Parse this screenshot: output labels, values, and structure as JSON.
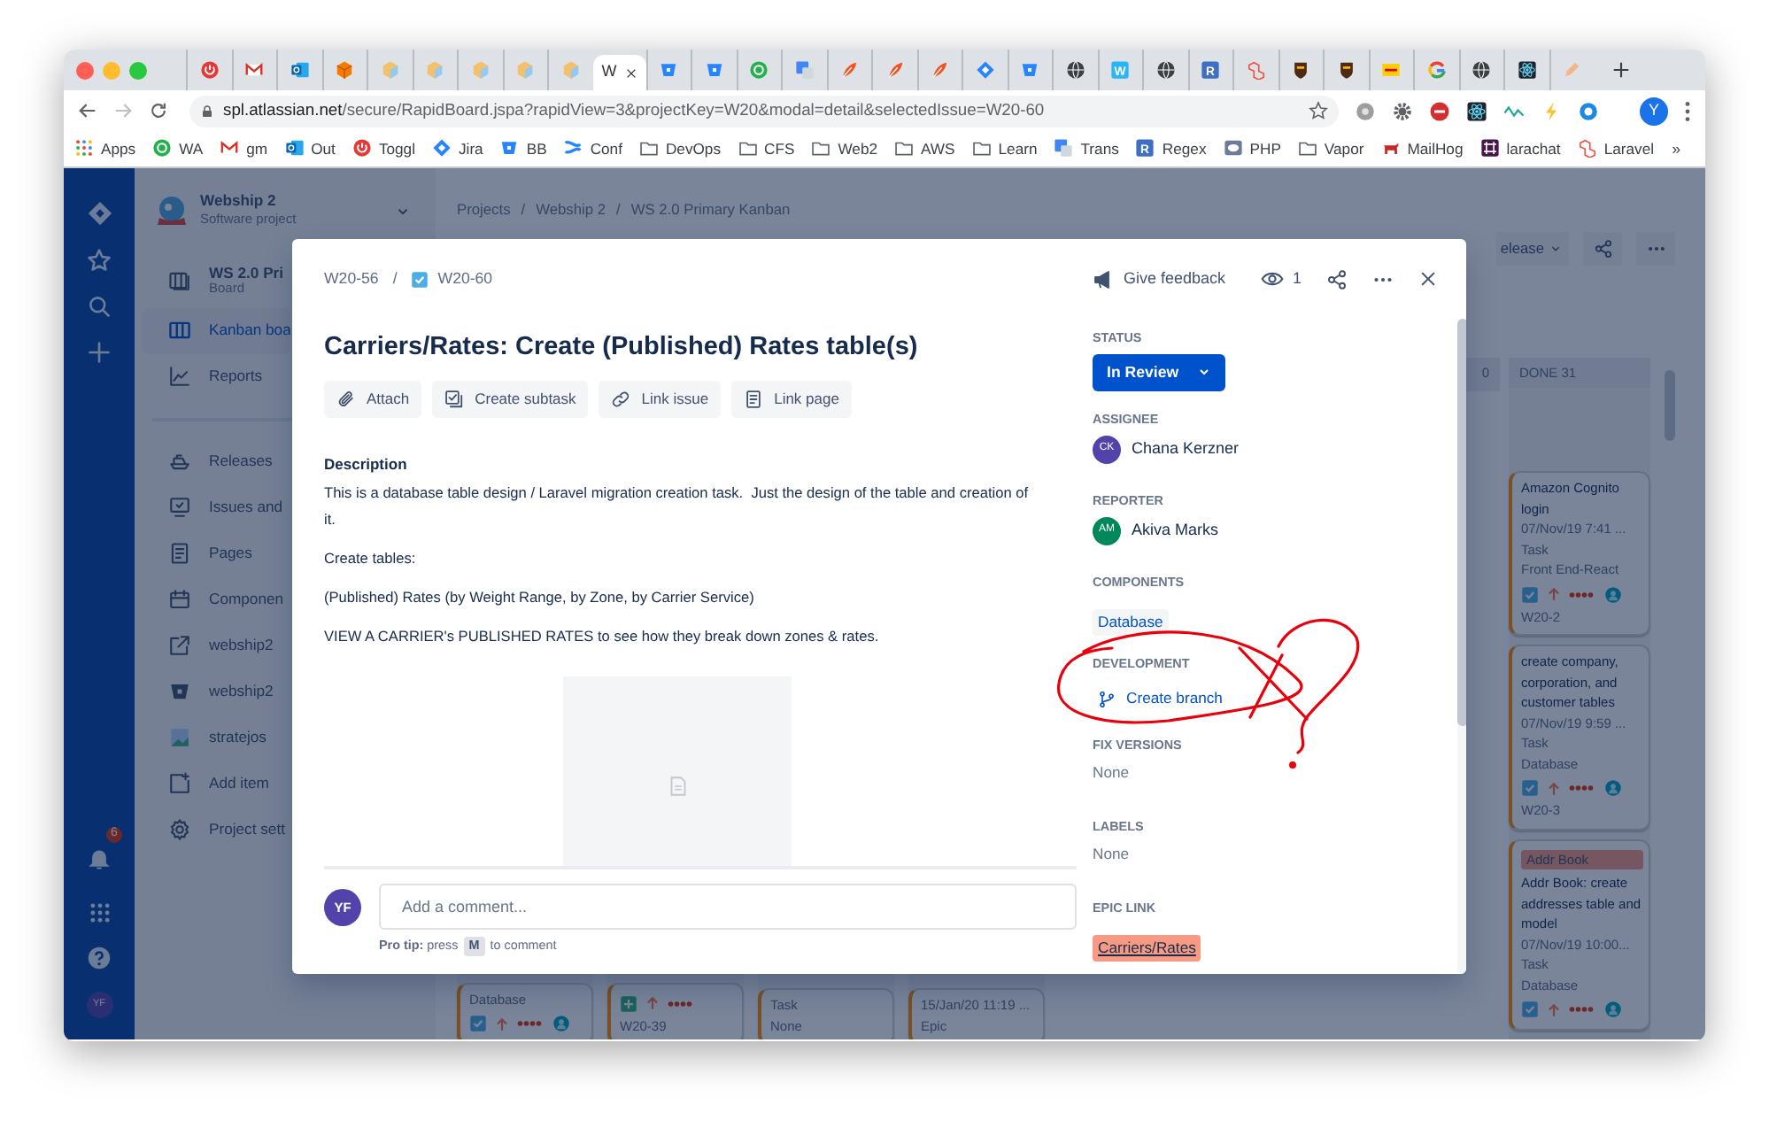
{
  "browser": {
    "tabs": [
      {
        "kind": "power",
        "selected": false
      },
      {
        "kind": "gmail",
        "selected": false
      },
      {
        "kind": "outlook",
        "selected": false
      },
      {
        "kind": "box",
        "selected": false
      },
      {
        "kind": "cube",
        "selected": false
      },
      {
        "kind": "cube",
        "selected": false
      },
      {
        "kind": "cube",
        "selected": false
      },
      {
        "kind": "cube",
        "selected": false
      },
      {
        "kind": "cube",
        "selected": false
      },
      {
        "kind": "page",
        "title": "W",
        "selected": true
      },
      {
        "kind": "bucket",
        "selected": false
      },
      {
        "kind": "bucket",
        "selected": false
      },
      {
        "kind": "chat",
        "selected": false
      },
      {
        "kind": "translate",
        "selected": false
      },
      {
        "kind": "feather",
        "selected": false
      },
      {
        "kind": "feather",
        "selected": false
      },
      {
        "kind": "feather",
        "selected": false
      },
      {
        "kind": "diamond",
        "selected": false
      },
      {
        "kind": "bucket",
        "selected": false
      },
      {
        "kind": "globe",
        "selected": false
      },
      {
        "kind": "tile",
        "glyph": "W",
        "color": "#29b6f6",
        "selected": false
      },
      {
        "kind": "globe",
        "selected": false
      },
      {
        "kind": "tile",
        "glyph": "R",
        "color": "#3f6fc4",
        "selected": false
      },
      {
        "kind": "laravel",
        "selected": false
      },
      {
        "kind": "ups",
        "selected": false
      },
      {
        "kind": "ups",
        "selected": false
      },
      {
        "kind": "dhl",
        "selected": false
      },
      {
        "kind": "google",
        "selected": false
      },
      {
        "kind": "globe",
        "selected": false
      },
      {
        "kind": "react",
        "selected": false
      },
      {
        "kind": "pen",
        "selected": false
      }
    ],
    "url": {
      "host": "spl.atlassian.net",
      "path": "/secure/RapidBoard.jspa?rapidView=3&projectKey=W20&modal=detail&selectedIssue=W20-60"
    },
    "extensions": [
      {
        "kind": "gray"
      },
      {
        "kind": "gear"
      },
      {
        "kind": "stop"
      },
      {
        "kind": "react"
      },
      {
        "kind": "wave"
      },
      {
        "kind": "bolt"
      },
      {
        "kind": "lifebuoy"
      }
    ],
    "profile_initial": "Y",
    "bookmarks": [
      {
        "label": "Apps",
        "kind": "apps"
      },
      {
        "label": "WA",
        "kind": "chat"
      },
      {
        "label": "gm",
        "kind": "gmail"
      },
      {
        "label": "Out",
        "kind": "outlook"
      },
      {
        "label": "Toggl",
        "kind": "power"
      },
      {
        "label": "Jira",
        "kind": "diamond"
      },
      {
        "label": "BB",
        "kind": "bucket"
      },
      {
        "label": "Conf",
        "kind": "confluence"
      },
      {
        "label": "DevOps",
        "kind": "folder"
      },
      {
        "label": "CFS",
        "kind": "folder"
      },
      {
        "label": "Web2",
        "kind": "folder"
      },
      {
        "label": "AWS",
        "kind": "folder"
      },
      {
        "label": "Learn",
        "kind": "folder"
      },
      {
        "label": "Trans",
        "kind": "translate"
      },
      {
        "label": "Regex",
        "kind": "tile",
        "glyph": "R",
        "color": "#3f6fc4"
      },
      {
        "label": "PHP",
        "kind": "php"
      },
      {
        "label": "Vapor",
        "kind": "folder"
      },
      {
        "label": "MailHog",
        "kind": "mailhog"
      },
      {
        "label": "larachat",
        "kind": "slack"
      },
      {
        "label": "Laravel",
        "kind": "laravel"
      }
    ],
    "bookmarks_overflow": "»"
  },
  "global_nav": {
    "notification_count": "6",
    "user_initials": "YF"
  },
  "project_sidebar": {
    "name": "Webship 2",
    "type": "Software project",
    "board_items": [
      {
        "label": "WS 2.0 Pri",
        "sublabel": "Board",
        "kind": "board",
        "selected": false
      },
      {
        "label": "Kanban boa",
        "kind": "columns",
        "selected": true
      },
      {
        "label": "Reports",
        "kind": "chart",
        "selected": false
      }
    ],
    "items": [
      {
        "label": "Releases",
        "kind": "ship"
      },
      {
        "label": "Issues and",
        "kind": "monitor"
      },
      {
        "label": "Pages",
        "kind": "page"
      },
      {
        "label": "Componen",
        "kind": "calendar"
      },
      {
        "label": "webship2",
        "kind": "external"
      },
      {
        "label": "webship2",
        "kind": "bucket"
      },
      {
        "label": "stratejos",
        "kind": "image"
      },
      {
        "label": "Add item",
        "kind": "add"
      },
      {
        "label": "Project sett",
        "kind": "gear"
      }
    ]
  },
  "board": {
    "breadcrumbs": [
      "Projects",
      "/",
      "Webship 2",
      "/",
      "WS 2.0 Primary Kanban"
    ],
    "release_button": "elease",
    "partial_cards": [
      {
        "component": "Database",
        "kind": "task",
        "assigned": true
      },
      {
        "kind": "feature",
        "assigned": false,
        "key": "W20-39"
      },
      {
        "type": "Task",
        "component": "None"
      },
      {
        "date": "15/Jan/20 11:19 ...",
        "type": "Epic"
      }
    ],
    "partial_column_header": "0",
    "done_column": {
      "title": "DONE 31",
      "cards": [
        {
          "title": "Amazon Cognito login",
          "date": "07/Nov/19 7:41 ...",
          "type": "Task",
          "component": "Front End-React",
          "kind": "task",
          "assigned": true,
          "key": "W20-2"
        },
        {
          "title": "create company, corporation, and customer tables",
          "date": "07/Nov/19 9:59 ...",
          "type": "Task",
          "component": "Database",
          "kind": "task",
          "assigned": true,
          "key": "W20-3"
        },
        {
          "title": "Addr Book: create addresses table and model",
          "tag": "Addr Book",
          "date": "07/Nov/19 10:00...",
          "type": "Task",
          "component": "Database",
          "kind": "task",
          "assigned": true
        }
      ]
    }
  },
  "issue": {
    "parent_key": "W20-56",
    "separator": "/",
    "key": "W20-60",
    "feedback": "Give feedback",
    "watchers": "1",
    "title": "Carriers/Rates: Create (Published) Rates table(s)",
    "actions": [
      {
        "label": "Attach",
        "kind": "clip"
      },
      {
        "label": "Create subtask",
        "kind": "subtask"
      },
      {
        "label": "Link issue",
        "kind": "link"
      },
      {
        "label": "Link page",
        "kind": "page"
      }
    ],
    "description_heading": "Description",
    "description": [
      "This is a database table design / Laravel migration creation task.  Just the design of the table and creation of it.",
      "Create tables:",
      "(Published) Rates (by Weight Range, by Zone, by Carrier Service)",
      "VIEW A CARRIER's PUBLISHED RATES to see how they break down zones & rates."
    ],
    "comment": {
      "user_initials": "YF",
      "placeholder": "Add a comment...",
      "tip_before": "**Pro tip:** press",
      "tip_key": "M",
      "tip_after": "to comment"
    },
    "fields": [
      {
        "label": "STATUS",
        "kind": "status",
        "value": "In Review"
      },
      {
        "label": "ASSIGNEE",
        "kind": "user",
        "value": "Chana Kerzner",
        "initials": "CK",
        "color": "#5243aa"
      },
      {
        "label": "REPORTER",
        "kind": "user",
        "value": "Akiva Marks",
        "initials": "AM",
        "color": "#00875a"
      },
      {
        "label": "COMPONENTS",
        "kind": "tag",
        "value": "Database"
      },
      {
        "label": "DEVELOPMENT",
        "kind": "branch",
        "value": "Create branch"
      },
      {
        "label": "FIX VERSIONS",
        "kind": "none",
        "value": "None"
      },
      {
        "label": "LABELS",
        "kind": "none",
        "value": "None"
      },
      {
        "label": "EPIC LINK",
        "kind": "epic",
        "value": "Carriers/Rates",
        "color": "#f79a83"
      }
    ]
  }
}
